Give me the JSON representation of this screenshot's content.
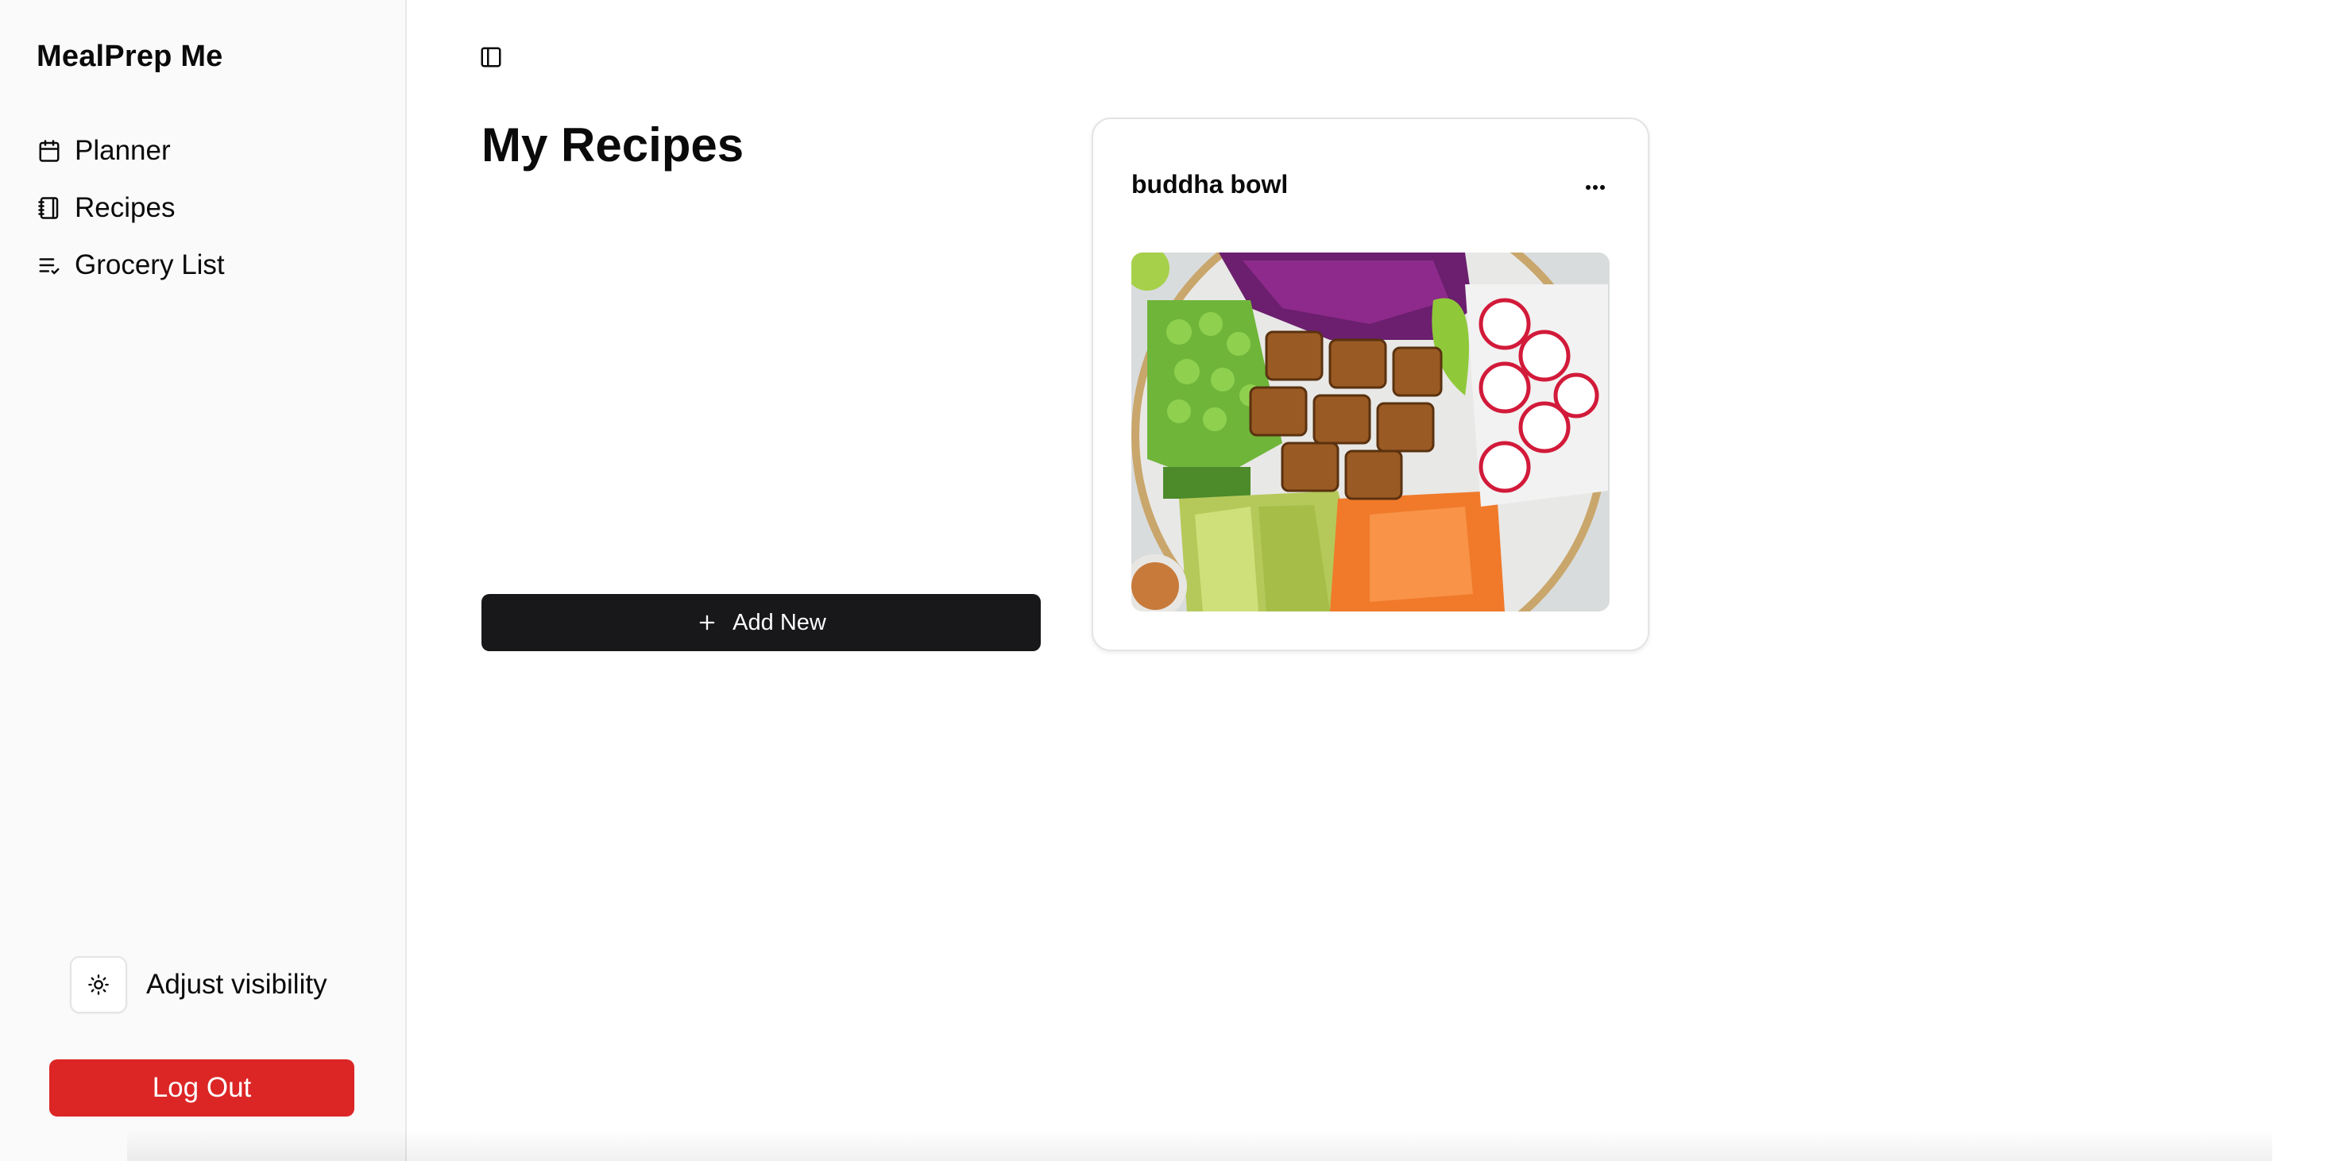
{
  "app": {
    "title": "MealPrep Me"
  },
  "sidebar": {
    "items": [
      {
        "label": "Planner",
        "icon": "calendar-icon"
      },
      {
        "label": "Recipes",
        "icon": "notebook-icon"
      },
      {
        "label": "Grocery List",
        "icon": "list-check-icon"
      }
    ],
    "visibility": {
      "label": "Adjust visibility",
      "icon": "sun-icon"
    },
    "logout_label": "Log Out"
  },
  "main": {
    "title": "My Recipes",
    "add_new_label": "Add New",
    "toggle_icon": "sidebar-toggle-icon",
    "recipes": [
      {
        "title": "buddha bowl",
        "menu_icon": "more-horizontal-icon",
        "image": "buddha-bowl-photo"
      }
    ]
  },
  "colors": {
    "sidebar_bg": "#fafafa",
    "primary_button": "#18181b",
    "danger_button": "#dc2626"
  }
}
